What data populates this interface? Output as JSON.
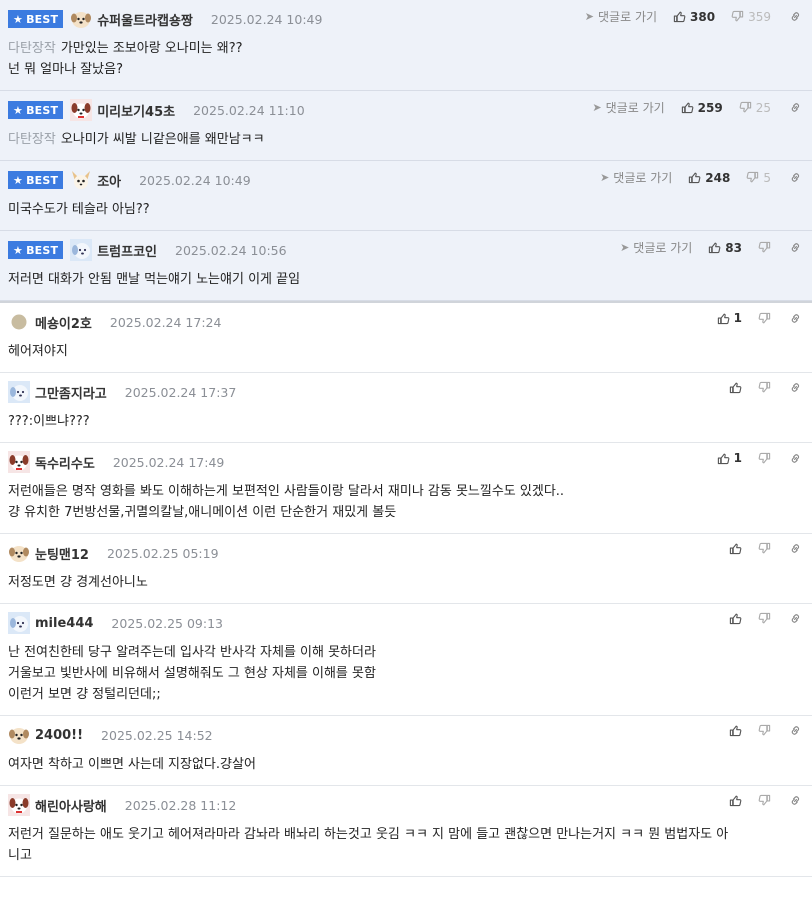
{
  "labels": {
    "best": "BEST",
    "reply": "댓글로 가기"
  },
  "colors": {
    "best_badge": "#3b7be0",
    "best_bg": "#eef2f9"
  },
  "best_comments": [
    {
      "avatar": "dog-icon",
      "nick": "슈퍼울트라캡숑짱",
      "date": "2025.02.24 10:49",
      "up": "380",
      "down": "359",
      "lines": [
        {
          "cat": "다탄장작",
          "text": "가만있는 조보아랑 오나미는 왜??"
        },
        {
          "cat": "",
          "text": "넌 뭐 얼마나 잘났음?"
        }
      ]
    },
    {
      "avatar": "puppy-red-icon",
      "nick": "미리보기45초",
      "date": "2025.02.24 11:10",
      "up": "259",
      "down": "25",
      "lines": [
        {
          "cat": "다탄장작",
          "text": "오나미가 씨발 니같은애를 왜만남ㅋㅋ"
        }
      ]
    },
    {
      "avatar": "chihuahua-icon",
      "nick": "조아",
      "date": "2025.02.24 10:49",
      "up": "248",
      "down": "5",
      "lines": [
        {
          "cat": "",
          "text": "미국수도가 테슬라 아님??"
        }
      ]
    },
    {
      "avatar": "puppy-blue-icon",
      "nick": "트럼프코인",
      "date": "2025.02.24 10:56",
      "up": "83",
      "down": "",
      "lines": [
        {
          "cat": "",
          "text": "저러면 대화가 안됨 맨날 먹는얘기 노는얘기 이게 끝임"
        }
      ]
    }
  ],
  "comments": [
    {
      "avatar": "dot-icon",
      "nick": "메숑이2호",
      "date": "2025.02.24 17:24",
      "up": "1",
      "lines": [
        "헤어져야지"
      ]
    },
    {
      "avatar": "puppy-blue-icon",
      "nick": "그만좀지라고",
      "date": "2025.02.24 17:37",
      "up": "",
      "lines": [
        "???:이쁘냐???"
      ]
    },
    {
      "avatar": "puppy-red-icon",
      "nick": "독수리수도",
      "date": "2025.02.24 17:49",
      "up": "1",
      "lines": [
        "저런애들은 명작 영화를 봐도 이해하는게 보편적인 사람들이랑 달라서 재미나 감동 못느낄수도 있겠다..",
        "걍 유치한 7번방선물,귀멸의칼날,애니메이션 이런 단순한거 재밌게 볼듯"
      ]
    },
    {
      "avatar": "dog-icon",
      "nick": "눈팅맨12",
      "date": "2025.02.25 05:19",
      "up": "",
      "lines": [
        "저정도면 걍 경계선아니노"
      ]
    },
    {
      "avatar": "puppy-blue-icon",
      "nick": "mile444",
      "date": "2025.02.25 09:13",
      "up": "",
      "lines": [
        "난 전여친한테 당구 알려주는데 입사각 반사각 자체를 이해 못하더라",
        "거울보고 빛반사에 비유해서 설명해줘도 그 현상 자체를 이해를 못함",
        "이런거 보면 걍 정털리던데;;"
      ]
    },
    {
      "avatar": "dog-icon",
      "nick": "2400!!",
      "date": "2025.02.25 14:52",
      "up": "",
      "lines": [
        "여자면 착하고 이쁘면 사는데 지장없다.걍살어"
      ]
    },
    {
      "avatar": "puppy-red-icon",
      "nick": "해린아사랑해",
      "date": "2025.02.28 11:12",
      "up": "",
      "lines": [
        "저런거 질문하는 애도 웃기고 헤어져라마라 감놔라 배놔리 하는것고 웃김 ㅋㅋ 지 맘에 들고 괜찮으면 만나는거지 ㅋㅋ 뭔 범법자도 아",
        "니고"
      ]
    }
  ]
}
